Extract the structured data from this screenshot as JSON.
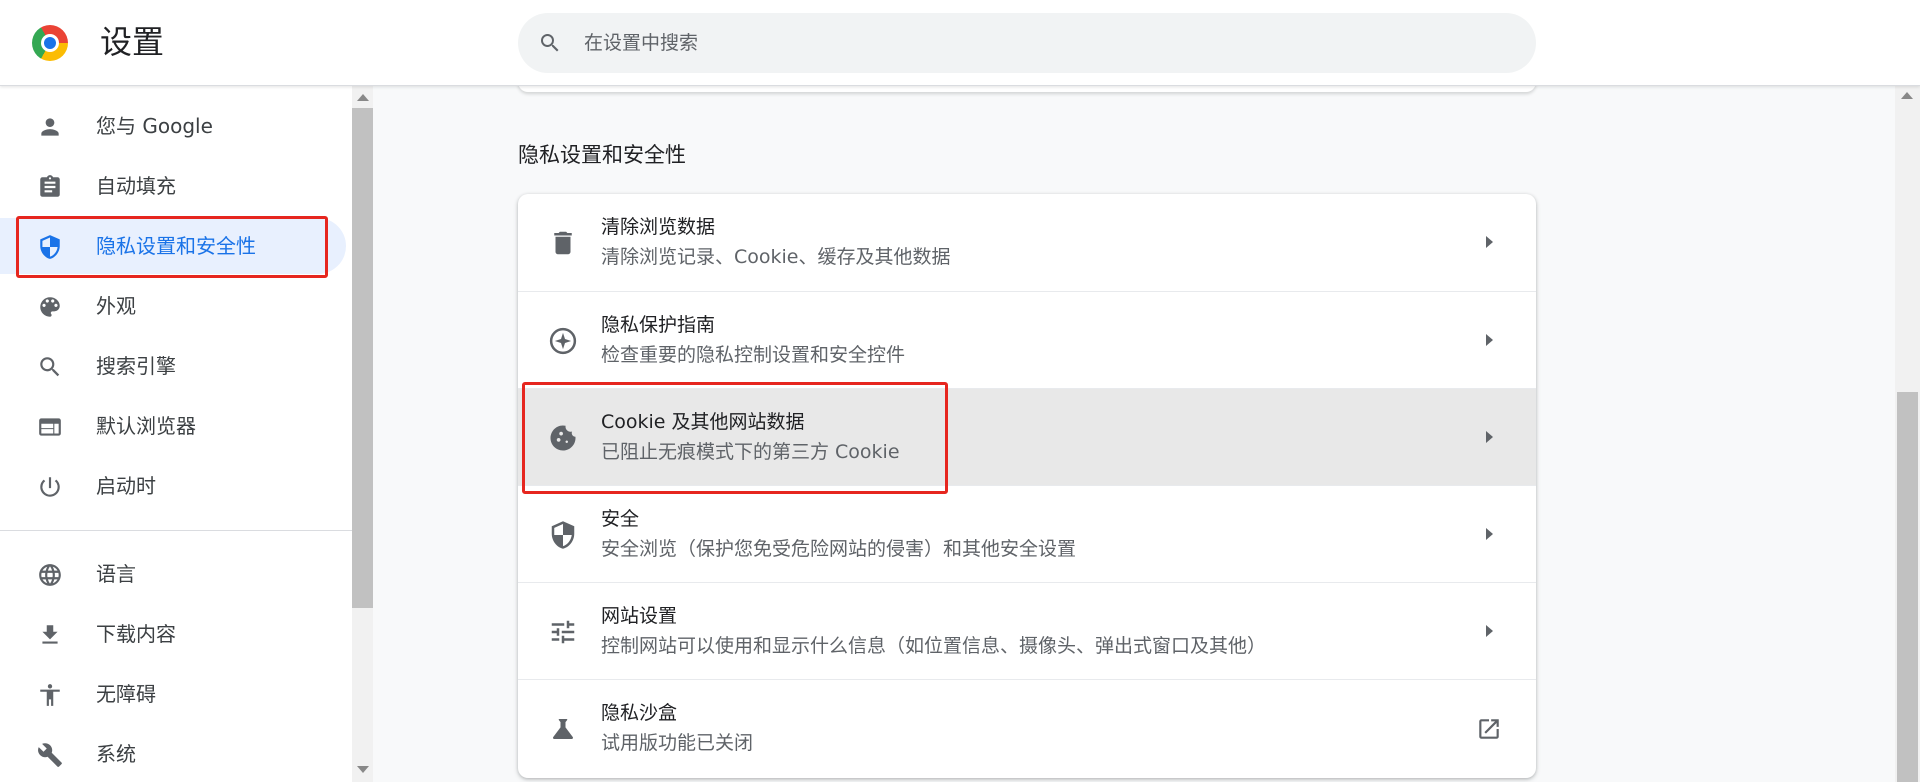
{
  "header": {
    "title": "设置",
    "search_placeholder": "在设置中搜索"
  },
  "sidebar": {
    "items": [
      {
        "label": "您与 Google",
        "icon": "person-icon"
      },
      {
        "label": "自动填充",
        "icon": "clipboard-icon"
      },
      {
        "label": "隐私设置和安全性",
        "icon": "shield-icon",
        "active": true
      },
      {
        "label": "外观",
        "icon": "palette-icon"
      },
      {
        "label": "搜索引擎",
        "icon": "search-icon"
      },
      {
        "label": "默认浏览器",
        "icon": "browser-icon"
      },
      {
        "label": "启动时",
        "icon": "power-icon"
      },
      {
        "label": "语言",
        "icon": "globe-icon"
      },
      {
        "label": "下载内容",
        "icon": "download-icon"
      },
      {
        "label": "无障碍",
        "icon": "accessibility-icon"
      },
      {
        "label": "系统",
        "icon": "wrench-icon"
      }
    ]
  },
  "main": {
    "section_title": "隐私设置和安全性",
    "rows": [
      {
        "title": "清除浏览数据",
        "subtitle": "清除浏览记录、Cookie、缓存及其他数据",
        "icon": "trash-icon"
      },
      {
        "title": "隐私保护指南",
        "subtitle": "检查重要的隐私控制设置和安全控件",
        "icon": "compass-icon"
      },
      {
        "title": "Cookie 及其他网站数据",
        "subtitle": "已阻止无痕模式下的第三方 Cookie",
        "icon": "cookie-icon"
      },
      {
        "title": "安全",
        "subtitle": "安全浏览（保护您免受危险网站的侵害）和其他安全设置",
        "icon": "security-shield-icon"
      },
      {
        "title": "网站设置",
        "subtitle": "控制网站可以使用和显示什么信息（如位置信息、摄像头、弹出式窗口及其他）",
        "icon": "tune-icon"
      },
      {
        "title": "隐私沙盒",
        "subtitle": "试用版功能已关闭",
        "icon": "flask-icon"
      }
    ]
  },
  "colors": {
    "accent": "#1a73e8",
    "highlight_box": "#e6261f",
    "active_bg": "#e8f0fe"
  }
}
